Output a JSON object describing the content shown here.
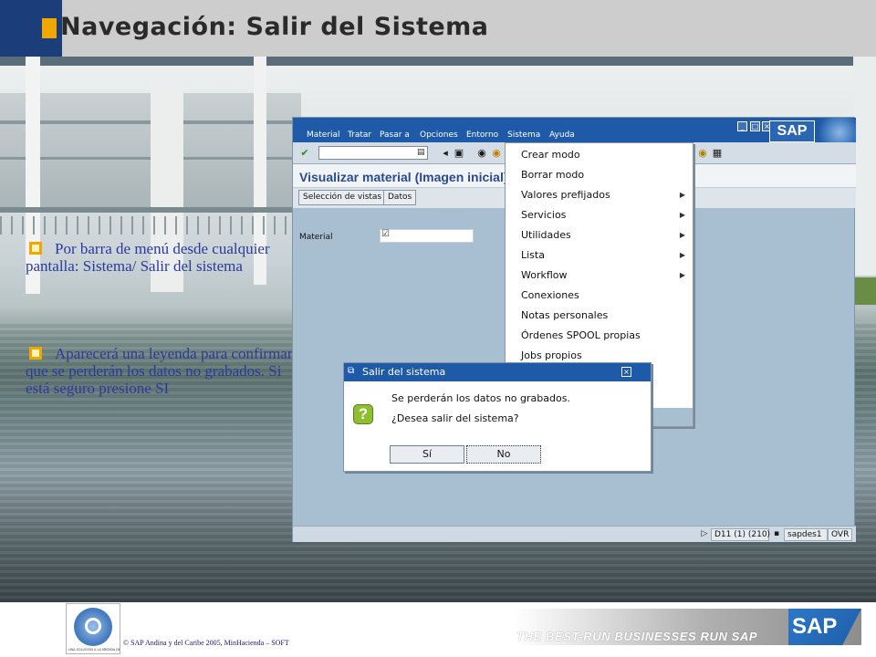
{
  "slide": {
    "title": "Navegación: Salir del Sistema",
    "bullets": [
      "Por barra de menú desde cualquier pantalla: Sistema/ Salir del sistema",
      "Aparecerá una leyenda para confirmar que se perderán los datos no grabados. Si está seguro presione SI"
    ],
    "copyright": "©  SAP Andina y del Caribe 2005, MinHacienda – SOFT",
    "footer_logo_caption": "UNA SOLUCIÓN A LA MEDIDA DE TODOS",
    "tagline": "THE BEST-RUN BUSINESSES RUN SAP",
    "footer_logo_text": "SAP",
    "accent_color": "#f0a800",
    "title_band_color": "#cdcdcd"
  },
  "sap": {
    "menubar": [
      "Material",
      "Tratar",
      "Pasar a",
      "Opciones",
      "Entorno",
      "Sistema",
      "Ayuda"
    ],
    "logo_text": "SAP",
    "screen_title": "Visualizar material (Imagen inicial)",
    "app_buttons": [
      "Selección de vistas",
      "Datos"
    ],
    "field_label": "Material",
    "status": {
      "system": "D11 (1) (210)",
      "server": "sapdes1",
      "mode": "OVR"
    },
    "window_color": "#a8bfd2",
    "menubar_color": "#1f5aa8"
  },
  "system_menu": {
    "items": [
      {
        "label": "Crear modo",
        "submenu": false
      },
      {
        "label": "Borrar modo",
        "submenu": false
      },
      {
        "label": "Valores prefijados",
        "submenu": true
      },
      {
        "label": "Servicios",
        "submenu": true
      },
      {
        "label": "Utilidades",
        "submenu": true
      },
      {
        "label": "Lista",
        "submenu": true
      },
      {
        "label": "Workflow",
        "submenu": true
      },
      {
        "label": "Conexiones",
        "submenu": false
      },
      {
        "label": "Notas personales",
        "submenu": false
      },
      {
        "label": "Órdenes SPOOL propias",
        "submenu": false
      },
      {
        "label": "Jobs propios",
        "submenu": false
      }
    ]
  },
  "dialog": {
    "title": "Salir del sistema",
    "message_line1": "Se perderán los datos no grabados.",
    "message_line2": "¿Desea salir del sistema?",
    "yes_label": "Sí",
    "no_label": "No"
  }
}
